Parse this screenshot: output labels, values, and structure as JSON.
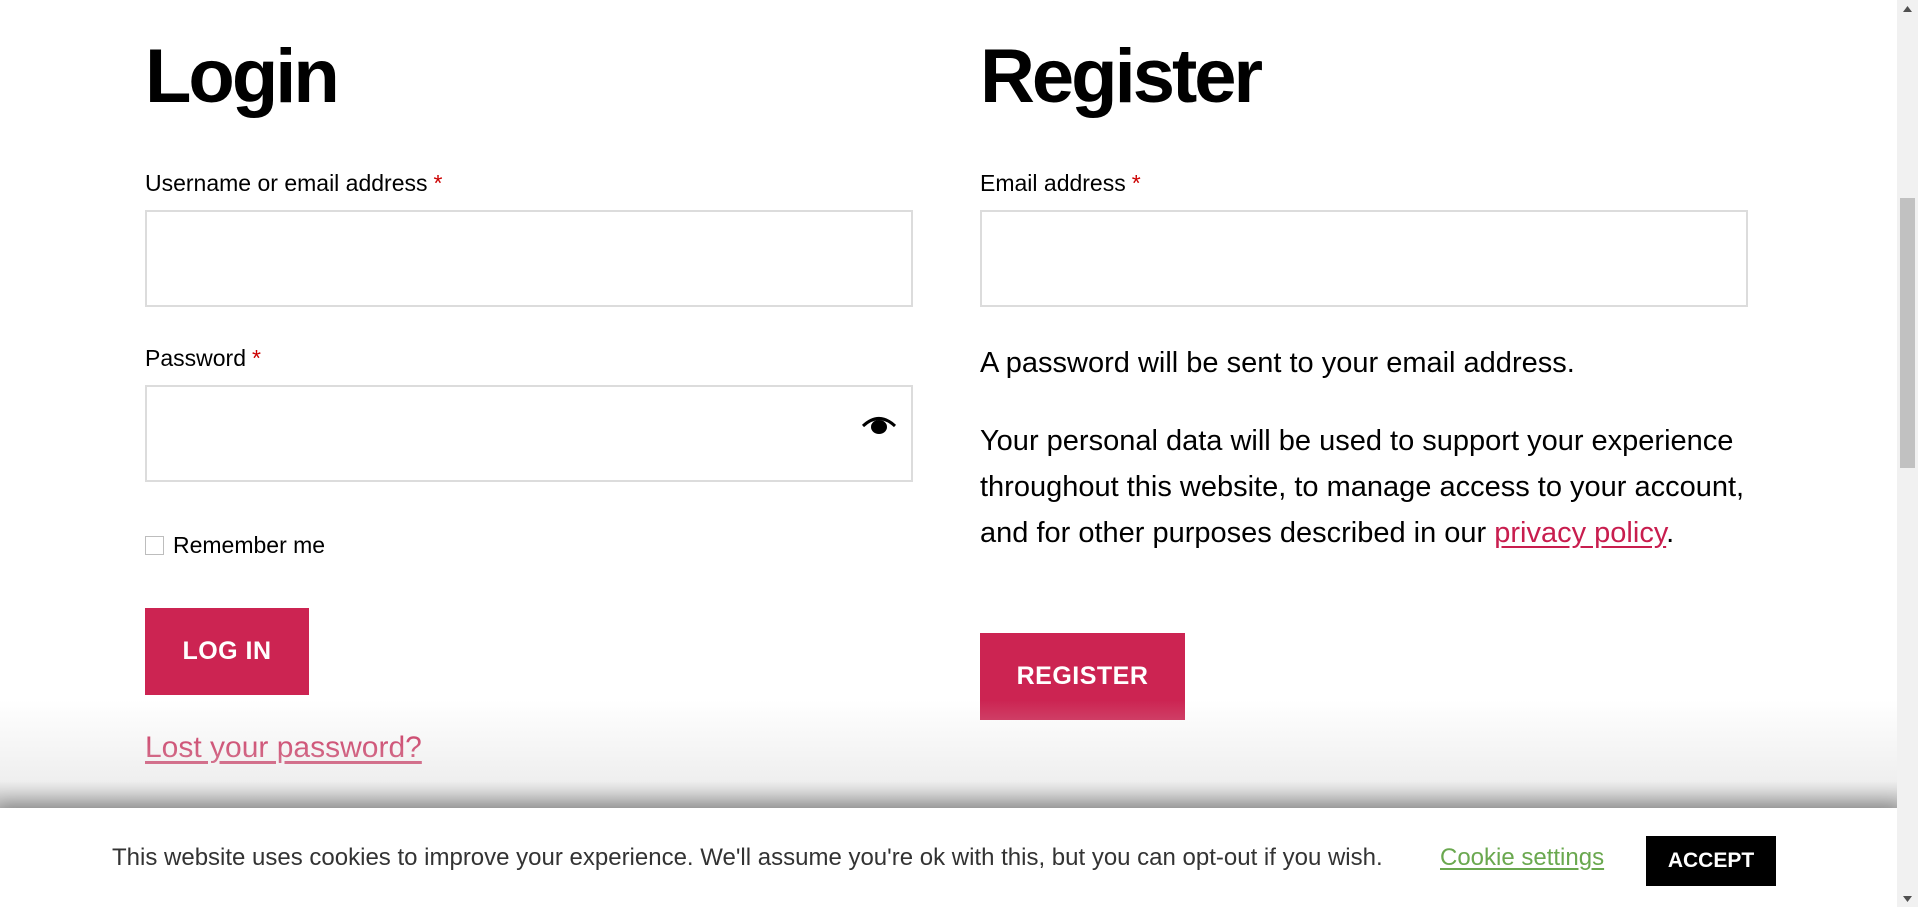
{
  "login": {
    "title": "Login",
    "username_label": "Username or email address",
    "username_required": "*",
    "password_label": "Password",
    "password_required": "*",
    "remember_label": "Remember me",
    "login_button": "LOG IN",
    "lost_password": "Lost your password?"
  },
  "register": {
    "title": "Register",
    "email_label": "Email address",
    "email_required": "*",
    "password_note": "A password will be sent to your email address.",
    "privacy_text_before": "Your personal data will be used to support your experience throughout this website, to manage access to your account, and for other purposes described in our ",
    "privacy_link": "privacy policy",
    "privacy_text_after": ".",
    "register_button": "REGISTER"
  },
  "cookie_bar": {
    "message": "This website uses cookies to improve your experience. We'll assume you're ok with this, but you can opt-out if you wish.",
    "settings_link": "Cookie settings",
    "accept_button": "ACCEPT"
  },
  "colors": {
    "accent": "#cc2452",
    "link": "#c81d4e",
    "cookie_link": "#6aa84f"
  },
  "icons": {
    "password_toggle": "eye-icon"
  }
}
